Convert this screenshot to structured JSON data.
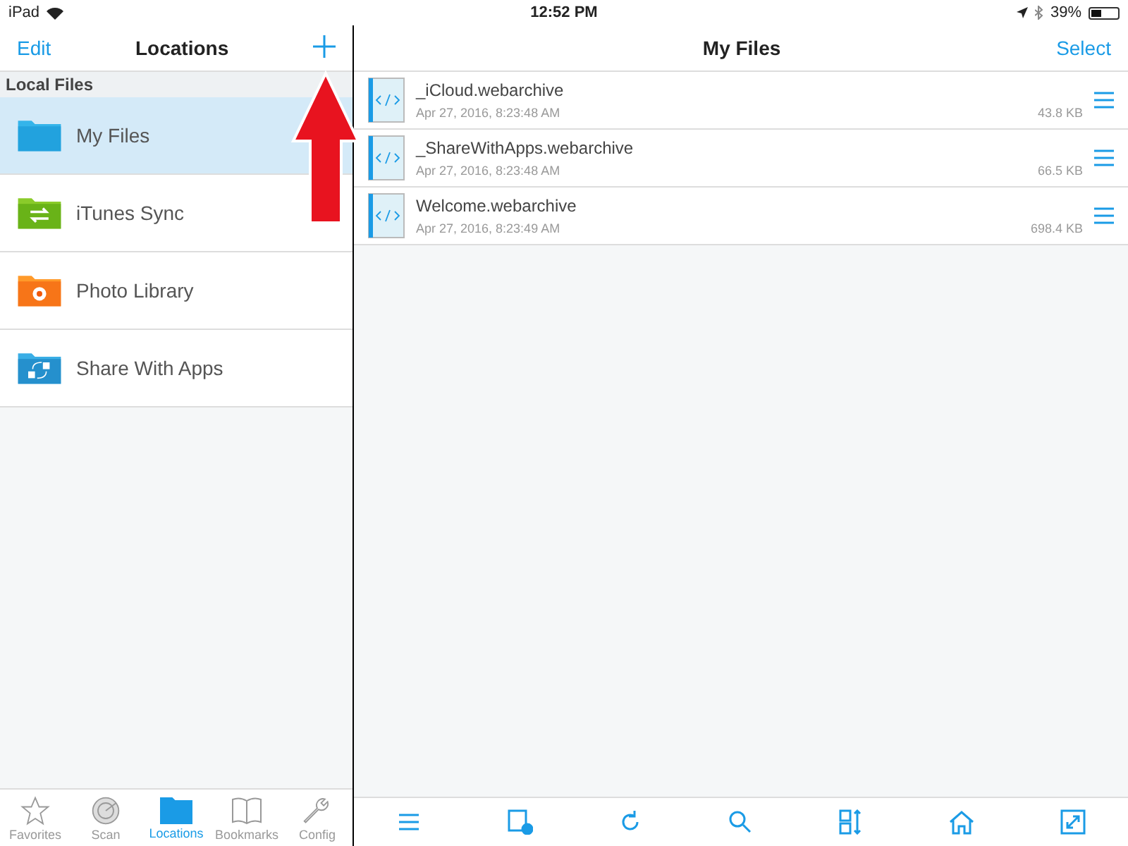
{
  "status_bar": {
    "device": "iPad",
    "time": "12:52 PM",
    "battery": "39%"
  },
  "sidebar": {
    "edit": "Edit",
    "title": "Locations",
    "section": "Local Files",
    "items": [
      {
        "label": "My Files",
        "kind": "plain",
        "selected": true
      },
      {
        "label": "iTunes Sync",
        "kind": "sync",
        "selected": false
      },
      {
        "label": "Photo Library",
        "kind": "photo",
        "selected": false
      },
      {
        "label": "Share With Apps",
        "kind": "share",
        "selected": false
      }
    ]
  },
  "tab_bar": [
    {
      "label": "Favorites",
      "kind": "star",
      "selected": false
    },
    {
      "label": "Scan",
      "kind": "radar",
      "selected": false
    },
    {
      "label": "Locations",
      "kind": "folder",
      "selected": true
    },
    {
      "label": "Bookmarks",
      "kind": "book",
      "selected": false
    },
    {
      "label": "Config",
      "kind": "wrench",
      "selected": false
    }
  ],
  "main": {
    "title": "My Files",
    "select": "Select",
    "files": [
      {
        "name": "_iCloud.webarchive",
        "date": "Apr 27, 2016, 8:23:48 AM",
        "size": "43.8 KB"
      },
      {
        "name": "_ShareWithApps.webarchive",
        "date": "Apr 27, 2016, 8:23:48 AM",
        "size": "66.5 KB"
      },
      {
        "name": "Welcome.webarchive",
        "date": "Apr 27, 2016, 8:23:49 AM",
        "size": "698.4 KB"
      }
    ]
  }
}
